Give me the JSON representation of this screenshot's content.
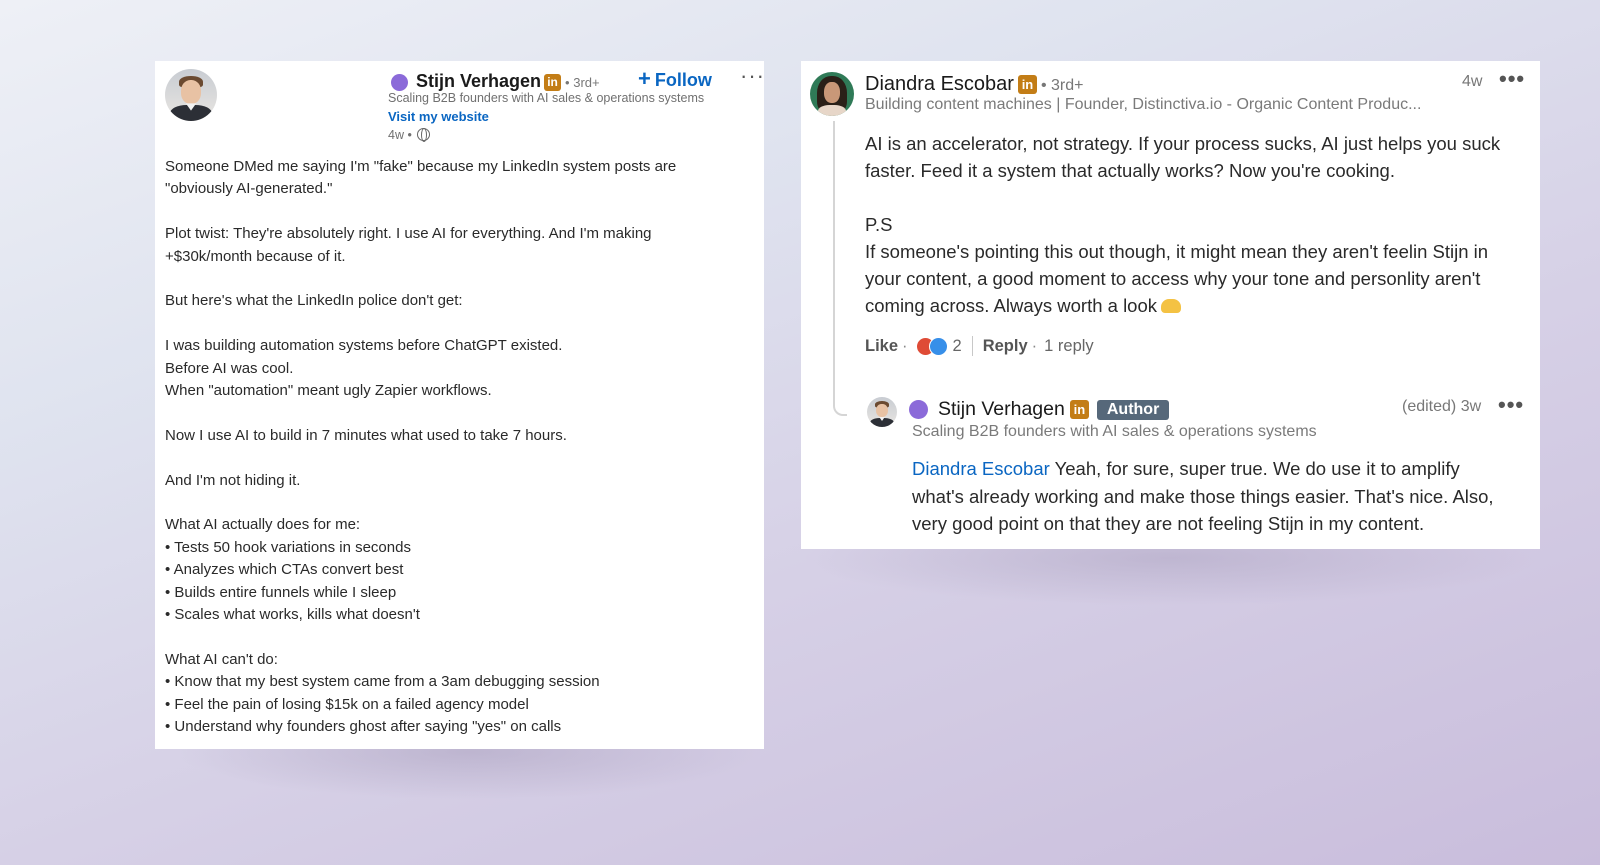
{
  "left_post": {
    "author_name": "Stijn Verhagen",
    "degree": "• 3rd+",
    "headline": "Scaling B2B founders with AI sales & operations systems",
    "website_link": "Visit my website",
    "time": "4w •",
    "follow_label": "Follow",
    "more": "···",
    "body": [
      [
        "Someone DMed me saying I'm \"fake\" because my LinkedIn system posts are",
        "\"obviously AI-generated.\""
      ],
      [
        "Plot twist: They're absolutely right. I use AI for everything. And I'm making",
        "+$30k/month because of it."
      ],
      [
        "But here's what the LinkedIn police don't get:"
      ],
      [
        "I was building automation systems before ChatGPT existed.",
        "Before AI was cool.",
        "When \"automation\" meant ugly Zapier workflows."
      ],
      [
        "Now I use AI to build in 7 minutes what used to take 7 hours."
      ],
      [
        "And I'm not hiding it."
      ],
      [
        "What AI actually does for me:",
        "• Tests 50 hook variations in seconds",
        "• Analyzes which CTAs convert best",
        "• Builds entire funnels while I sleep",
        "• Scales what works, kills what doesn't"
      ],
      [
        "What AI can't do:",
        "• Know that my best system came from a 3am debugging session",
        "• Feel the pain of losing $15k on a failed agency model",
        "• Understand why founders ghost after saying \"yes\" on calls"
      ]
    ]
  },
  "right_comment": {
    "author_name": "Diandra Escobar",
    "degree": "• 3rd+",
    "headline": "Building content machines | Founder, Distinctiva.io - Organic Content Produc...",
    "time": "4w",
    "more": "•••",
    "body": [
      "AI is an accelerator, not strategy. If your process sucks, AI just helps you suck",
      "faster. Feed it a system that actually works? Now you're cooking.",
      "",
      "P.S",
      "If someone's pointing this out though, it might mean they aren't feelin Stijn in",
      "your content, a good moment to access why your tone and personlity aren't",
      "coming across. Always worth a look"
    ],
    "like_label": "Like",
    "reaction_count": "2",
    "reply_label": "Reply",
    "replies_count": "1 reply",
    "reply": {
      "author_name": "Stijn Verhagen",
      "author_badge": "Author",
      "headline": "Scaling B2B founders with AI sales & operations systems",
      "time": "(edited) 3w",
      "more": "•••",
      "mention": "Diandra Escobar",
      "first_line_rest": " Yeah, for sure, super true. We do use it to amplify",
      "lines": [
        "what's already working and make those things easier. That's nice. Also,",
        "very good point on that they are not feeling Stijn in my content."
      ]
    }
  },
  "colors": {
    "linkedin_blue": "#0a66c2",
    "in_badge": "#c37d16",
    "purple_dot": "#8b6ad9",
    "author_badge": "#56687a"
  }
}
